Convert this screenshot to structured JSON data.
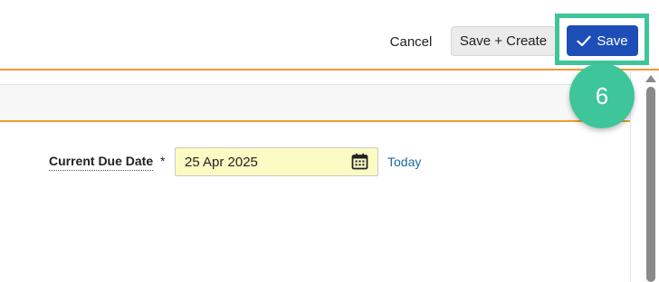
{
  "toolbar": {
    "cancel_label": "Cancel",
    "save_create_label": "Save + Create",
    "save_label": "Save",
    "save_icon": "checkmark-icon"
  },
  "annotation": {
    "step_number": "6",
    "color": "#3ec59a"
  },
  "form": {
    "current_due_date": {
      "label": "Current Due Date",
      "required_mark": "*",
      "value": "25 Apr 2025",
      "icon": "calendar-icon",
      "today_link": "Today"
    }
  },
  "colors": {
    "accent_orange": "#f29b2c",
    "primary_blue": "#1d4eb8",
    "input_highlight": "#fdfbc4",
    "link_blue": "#1a6aa8"
  }
}
